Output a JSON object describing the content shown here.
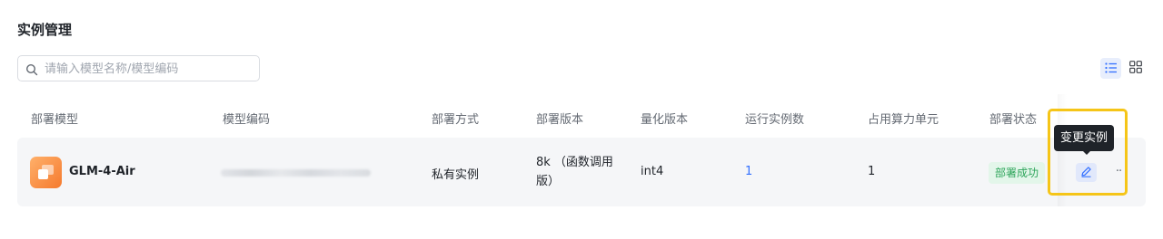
{
  "page": {
    "title": "实例管理"
  },
  "search": {
    "placeholder": "请输入模型名称/模型编码",
    "value": ""
  },
  "view_toggle": {
    "active": "list",
    "options": [
      "list",
      "grid"
    ]
  },
  "table": {
    "columns": [
      "部署模型",
      "模型编码",
      "部署方式",
      "部署版本",
      "量化版本",
      "运行实例数",
      "占用算力单元",
      "部署状态"
    ],
    "rows": [
      {
        "model_name": "GLM-4-Air",
        "model_code": "",
        "deploy_method": "私有实例",
        "deploy_version": "8k （函数调用版）",
        "quantization": "int4",
        "running_instances": "1",
        "compute_units": "1",
        "status": "部署成功",
        "actions": {
          "edit_tooltip": "变更实例",
          "more_label": "··"
        }
      }
    ]
  },
  "colors": {
    "accent": "#3370ff",
    "status_success_text": "#2ea55b",
    "status_success_bg": "#e3f6ea",
    "highlight": "#f5c518",
    "tooltip_bg": "#1f2329",
    "model_icon": "#f57a2e"
  },
  "icons": {
    "search": "search-icon",
    "list_view": "list-view-icon",
    "grid_view": "grid-view-icon",
    "model": "model-logo-icon",
    "edit": "edit-pencil-icon",
    "more": "more-horizontal-icon"
  }
}
